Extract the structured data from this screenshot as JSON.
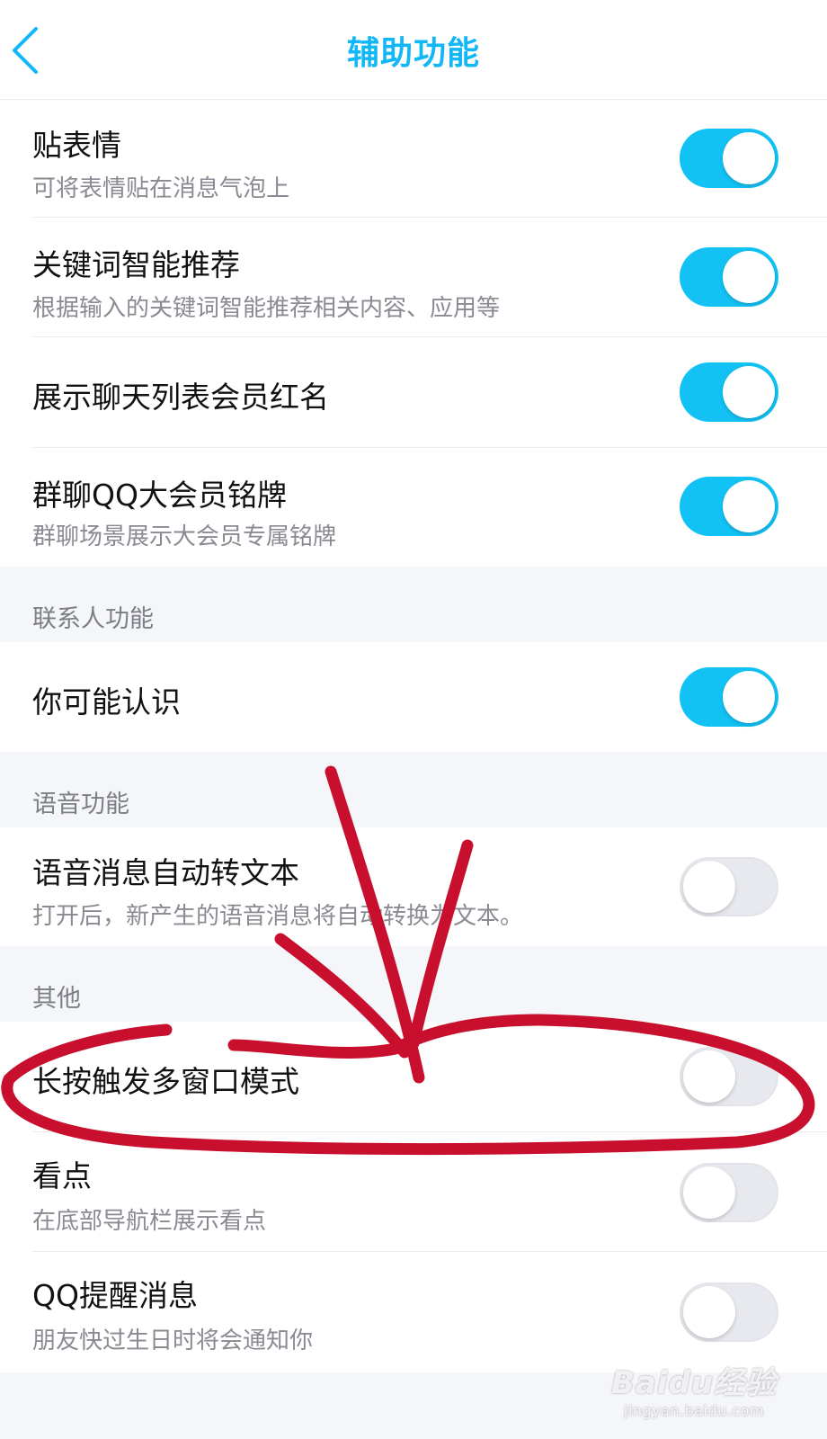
{
  "nav": {
    "title": "辅助功能",
    "back_icon": "chevron-left-icon"
  },
  "colors": {
    "accent": "#12b7f5",
    "toggle_on": "#12c2f5",
    "toggle_off": "#e7e9ef",
    "annotation": "#c8102e"
  },
  "group1": {
    "rows": [
      {
        "title": "贴表情",
        "subtitle": "可将表情贴在消息气泡上",
        "enabled": true
      },
      {
        "title": "关键词智能推荐",
        "subtitle": "根据输入的关键词智能推荐相关内容、应用等",
        "enabled": true
      },
      {
        "title": "展示聊天列表会员红名",
        "enabled": true
      },
      {
        "title": "群聊QQ大会员铭牌",
        "subtitle": "群聊场景展示大会员专属铭牌",
        "enabled": true
      }
    ]
  },
  "contacts_section": {
    "header": "联系人功能",
    "rows": [
      {
        "title": "你可能认识",
        "enabled": true
      }
    ]
  },
  "voice_section": {
    "header": "语音功能",
    "rows": [
      {
        "title": "语音消息自动转文本",
        "subtitle": "打开后，新产生的语音消息将自动转换为文本。",
        "enabled": false
      }
    ]
  },
  "other_section": {
    "header": "其他",
    "rows": [
      {
        "title": "长按触发多窗口模式",
        "enabled": false,
        "highlighted": true
      },
      {
        "title": "看点",
        "subtitle": "在底部导航栏展示看点",
        "enabled": false
      },
      {
        "title": "QQ提醒消息",
        "subtitle": "朋友快过生日时将会通知你",
        "enabled": false
      }
    ]
  },
  "watermark": {
    "text": "Baidu经验",
    "url": "jingyan.baidu.com"
  }
}
